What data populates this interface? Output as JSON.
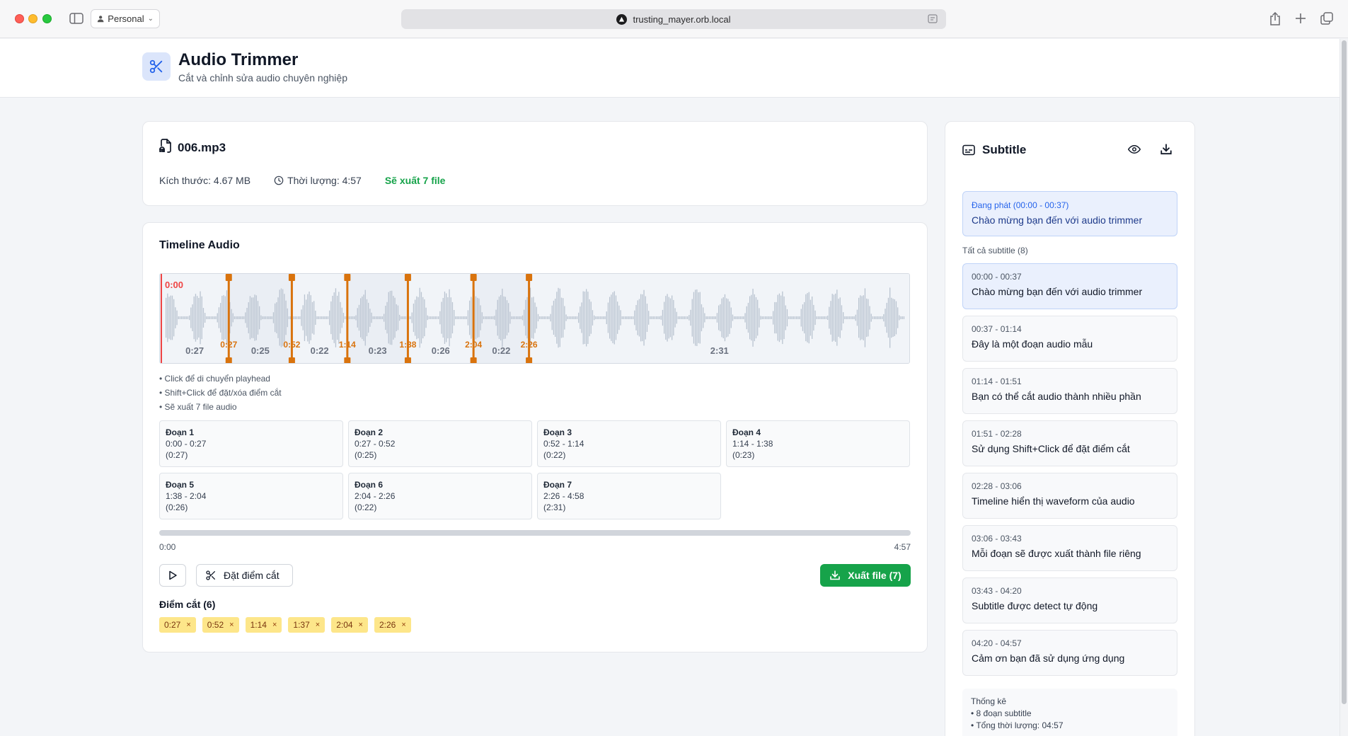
{
  "browser": {
    "profile_label": "Personal",
    "url": "trusting_mayer.orb.local"
  },
  "app": {
    "title": "Audio Trimmer",
    "subtitle": "Cắt và chỉnh sửa audio chuyên nghiệp"
  },
  "file": {
    "name": "006.mp3",
    "size_text": "Kích thước: 4.67 MB",
    "duration_text": "Thời lượng: 4:57",
    "export_text": "Sẽ xuất 7 file"
  },
  "timeline": {
    "title": "Timeline Audio",
    "playhead_label": "0:00",
    "total_seconds": 297,
    "cut_marker_labels": [
      "0:27",
      "0:52",
      "1:14",
      "1:38",
      "2:04",
      "2:26"
    ],
    "cut_marker_seconds": [
      27,
      52,
      74,
      98,
      124,
      146
    ],
    "segment_length_labels": [
      "0:27",
      "0:25",
      "0:22",
      "0:23",
      "0:26",
      "0:22",
      "2:31"
    ],
    "help": [
      "• Click để di chuyển playhead",
      "• Shift+Click để đặt/xóa điểm cắt",
      "• Sẽ xuất 7 file audio"
    ],
    "segments": [
      {
        "name": "Đoạn 1",
        "range": "0:00 - 0:27",
        "length": "(0:27)"
      },
      {
        "name": "Đoạn 2",
        "range": "0:27 - 0:52",
        "length": "(0:25)"
      },
      {
        "name": "Đoạn 3",
        "range": "0:52 - 1:14",
        "length": "(0:22)"
      },
      {
        "name": "Đoạn 4",
        "range": "1:14 - 1:38",
        "length": "(0:23)"
      },
      {
        "name": "Đoạn 5",
        "range": "1:38 - 2:04",
        "length": "(0:26)"
      },
      {
        "name": "Đoạn 6",
        "range": "2:04 - 2:26",
        "length": "(0:22)"
      },
      {
        "name": "Đoạn 7",
        "range": "2:26 - 4:58",
        "length": "(2:31)"
      }
    ],
    "progress_fraction": 0,
    "time_start": "0:00",
    "time_end": "4:57",
    "set_cut_label": "Đặt điểm cắt",
    "export_label": "Xuất file (7)",
    "cut_points_title": "Điểm cắt (6)",
    "cut_points": [
      "0:27",
      "0:52",
      "1:14",
      "1:37",
      "2:04",
      "2:26"
    ],
    "chip_remove_symbol": "×"
  },
  "subtitle_panel": {
    "title": "Subtitle",
    "now_playing_label": "Đang phát (00:00 - 00:37)",
    "now_playing_text": "Chào mừng bạn đến với audio trimmer",
    "all_label": "Tất cả subtitle (8)",
    "items": [
      {
        "time": "00:00 - 00:37",
        "text": "Chào mừng bạn đến với audio trimmer",
        "active": true
      },
      {
        "time": "00:37 - 01:14",
        "text": "Đây là một đoạn audio mẫu",
        "active": false
      },
      {
        "time": "01:14 - 01:51",
        "text": "Bạn có thể cắt audio thành nhiều phần",
        "active": false
      },
      {
        "time": "01:51 - 02:28",
        "text": "Sử dụng Shift+Click để đặt điểm cắt",
        "active": false
      },
      {
        "time": "02:28 - 03:06",
        "text": "Timeline hiển thị waveform của audio",
        "active": false
      },
      {
        "time": "03:06 - 03:43",
        "text": "Mỗi đoạn sẽ được xuất thành file riêng",
        "active": false
      },
      {
        "time": "03:43 - 04:20",
        "text": "Subtitle được detect tự động",
        "active": false
      },
      {
        "time": "04:20 - 04:57",
        "text": "Cảm ơn bạn đã sử dụng ứng dụng",
        "active": false
      }
    ],
    "stats_title": "Thống kê",
    "stats_lines": [
      "• 8 đoạn subtitle",
      "• Tổng thời lượng: 04:57"
    ]
  },
  "colors": {
    "accent": "#16a34a",
    "marker": "#d9730d",
    "playhead": "#ef4444",
    "waveform": "#b9c3d0"
  }
}
